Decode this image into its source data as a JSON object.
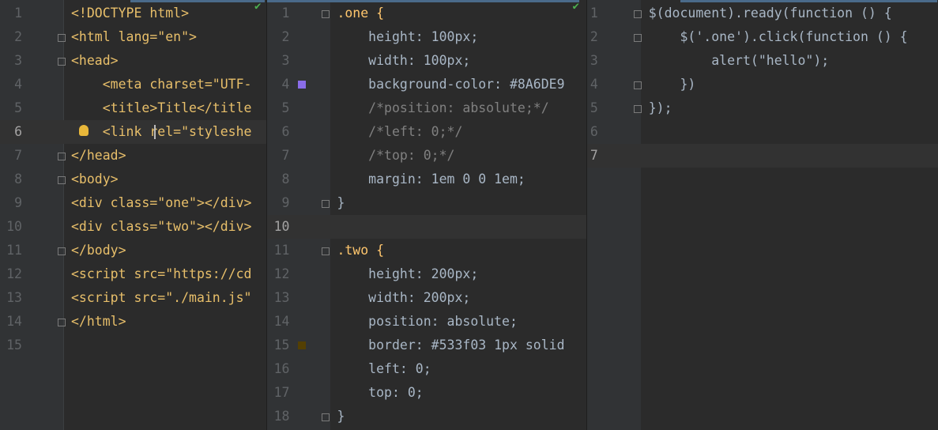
{
  "html_pane": {
    "line_numbers": [
      "1",
      "2",
      "3",
      "4",
      "5",
      "6",
      "7",
      "8",
      "9",
      "10",
      "11",
      "12",
      "13",
      "14",
      "15"
    ],
    "lines": [
      "<!DOCTYPE html>",
      "<html lang=\"en\">",
      "<head>",
      "    <meta charset=\"UTF-",
      "    <title>Title</title",
      "    <link rel=\"styleshe",
      "</head>",
      "<body>",
      "<div class=\"one\"></div>",
      "<div class=\"two\"></div>",
      "</body>",
      "<script src=\"https://cd",
      "<script src=\"./main.js\"",
      "</html>",
      ""
    ]
  },
  "css_pane": {
    "line_numbers": [
      "1",
      "2",
      "3",
      "4",
      "5",
      "6",
      "7",
      "8",
      "9",
      "10",
      "11",
      "12",
      "13",
      "14",
      "15",
      "16",
      "17",
      "18"
    ],
    "lines": [
      ".one {",
      "    height: 100px;",
      "    width: 100px;",
      "    background-color: #8A6DE9",
      "    /*position: absolute;*/",
      "    /*left: 0;*/",
      "    /*top: 0;*/",
      "    margin: 1em 0 0 1em;",
      "}",
      "",
      ".two {",
      "    height: 200px;",
      "    width: 200px;",
      "    position: absolute;",
      "    border: #533f03 1px solid",
      "    left: 0;",
      "    top: 0;",
      "}"
    ],
    "swatch_colors": {
      "line4": "#8A6DE9",
      "line15": "#533f03"
    }
  },
  "js_pane": {
    "line_numbers": [
      "1",
      "2",
      "3",
      "4",
      "5",
      "6",
      "7"
    ],
    "lines": [
      "$(document).ready(function () {",
      "    $('.one').click(function () {",
      "        alert(\"hello\");",
      "    })",
      "});",
      "",
      ""
    ]
  },
  "icons": [
    "check-icon",
    "lightbulb-icon",
    "fold-icon",
    "color-swatch-icon"
  ],
  "colors": {
    "background": "#2b2b2b",
    "gutter": "#313335",
    "tag": "#e8bf6a",
    "string": "#6a8759",
    "number": "#6897bb",
    "keyword": "#cc7832",
    "comment": "#808080",
    "function": "#ffc66d"
  }
}
